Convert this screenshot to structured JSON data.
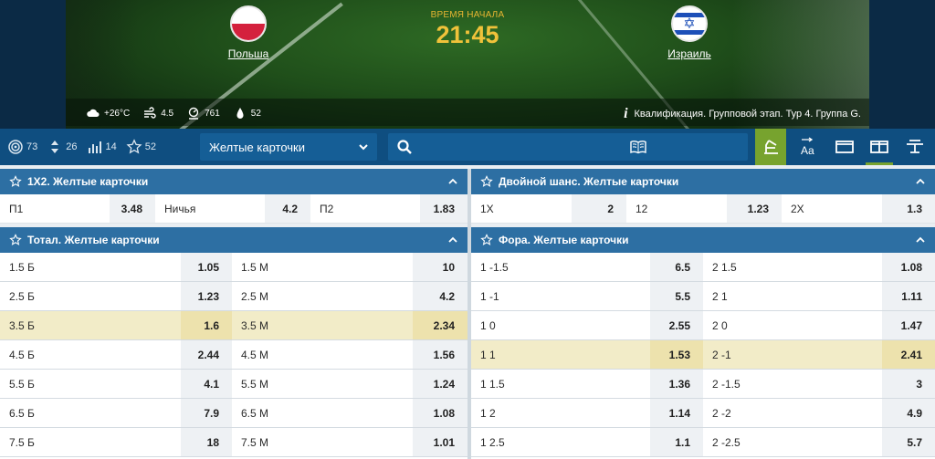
{
  "match": {
    "home": {
      "name": "Польша",
      "flag": "poland-flag"
    },
    "away": {
      "name": "Израиль",
      "flag": "israel-flag"
    },
    "start_label": "ВРЕМЯ НАЧАЛА",
    "start_time": "21:45",
    "weather": [
      {
        "icon": "cloud-icon",
        "value": "+26°C"
      },
      {
        "icon": "wind-icon",
        "value": "4.5"
      },
      {
        "icon": "pressure-icon",
        "value": "761"
      },
      {
        "icon": "humidity-icon",
        "value": "52"
      }
    ],
    "competition": "Квалификация. Групповой этап. Тур 4. Группа G."
  },
  "toolbar": {
    "counters": [
      {
        "icon": "all-markets-icon",
        "value": "73"
      },
      {
        "icon": "sort-icon",
        "value": "26"
      },
      {
        "icon": "stats-icon",
        "value": "14"
      },
      {
        "icon": "favorites-star-icon",
        "value": "52"
      }
    ],
    "market_select": "Желтые карточки",
    "colors": {
      "bar": "#0f4e80",
      "active": "#77a32e",
      "header": "#2d6fa3",
      "highlight": "#f2ecc8"
    }
  },
  "markets": {
    "x12": {
      "title": "1X2. Желтые карточки",
      "outcomes": [
        {
          "label": "П1",
          "odd": "3.48"
        },
        {
          "label": "Ничья",
          "odd": "4.2"
        },
        {
          "label": "П2",
          "odd": "1.83"
        }
      ]
    },
    "double": {
      "title": "Двойной шанс. Желтые карточки",
      "outcomes": [
        {
          "label": "1X",
          "odd": "2"
        },
        {
          "label": "12",
          "odd": "1.23"
        },
        {
          "label": "2X",
          "odd": "1.3"
        }
      ]
    },
    "total": {
      "title": "Тотал. Желтые карточки",
      "rows": [
        {
          "a": "1.5 Б",
          "ao": "1.05",
          "b": "1.5 М",
          "bo": "10"
        },
        {
          "a": "2.5 Б",
          "ao": "1.23",
          "b": "2.5 М",
          "bo": "4.2"
        },
        {
          "a": "3.5 Б",
          "ao": "1.6",
          "b": "3.5 М",
          "bo": "2.34"
        },
        {
          "a": "4.5 Б",
          "ao": "2.44",
          "b": "4.5 М",
          "bo": "1.56"
        },
        {
          "a": "5.5 Б",
          "ao": "4.1",
          "b": "5.5 М",
          "bo": "1.24"
        },
        {
          "a": "6.5 Б",
          "ao": "7.9",
          "b": "6.5 М",
          "bo": "1.08"
        },
        {
          "a": "7.5 Б",
          "ao": "18",
          "b": "7.5 М",
          "bo": "1.01"
        }
      ]
    },
    "handicap": {
      "title": "Фора. Желтые карточки",
      "rows": [
        {
          "a": "1 -1.5",
          "ao": "6.5",
          "b": "2 1.5",
          "bo": "1.08"
        },
        {
          "a": "1 -1",
          "ao": "5.5",
          "b": "2 1",
          "bo": "1.11"
        },
        {
          "a": "1 0",
          "ao": "2.55",
          "b": "2 0",
          "bo": "1.47"
        },
        {
          "a": "1 1",
          "ao": "1.53",
          "b": "2 -1",
          "bo": "2.41"
        },
        {
          "a": "1 1.5",
          "ao": "1.36",
          "b": "2 -1.5",
          "bo": "3"
        },
        {
          "a": "1 2",
          "ao": "1.14",
          "b": "2 -2",
          "bo": "4.9"
        },
        {
          "a": "1 2.5",
          "ao": "1.1",
          "b": "2 -2.5",
          "bo": "5.7"
        }
      ]
    }
  }
}
